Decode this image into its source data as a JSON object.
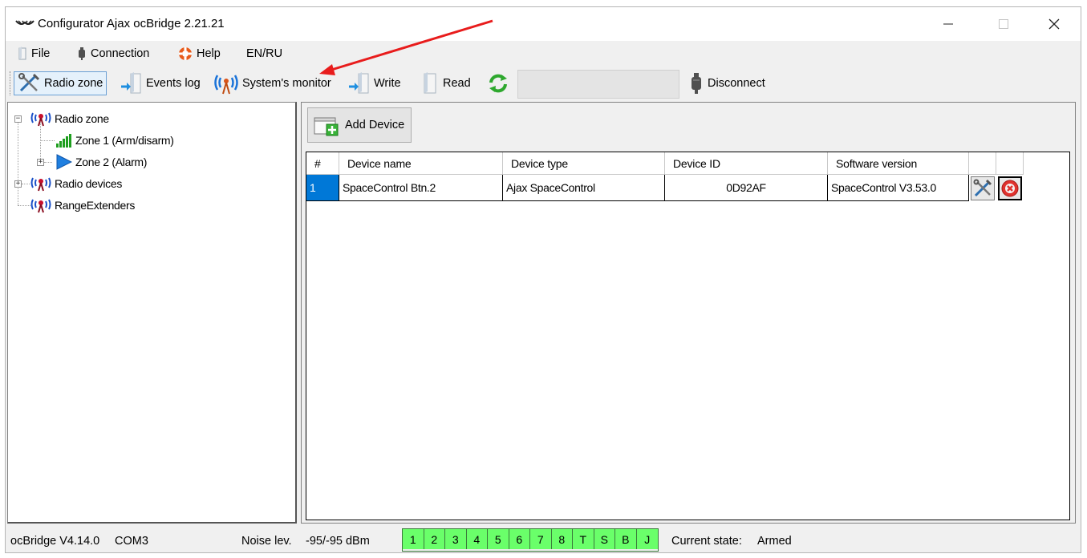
{
  "window": {
    "title": "Configurator Ajax ocBridge 2.21.21"
  },
  "menu": {
    "file": "File",
    "connection": "Connection",
    "help": "Help",
    "language": "EN/RU"
  },
  "toolbar": {
    "radio_zone": "Radio zone",
    "events_log": "Events log",
    "systems_monitor": "System's monitor",
    "write": "Write",
    "read": "Read",
    "disconnect": "Disconnect"
  },
  "tree": {
    "radio_zone": "Radio zone",
    "zone1": "Zone 1 (Arm/disarm)",
    "zone2": "Zone 2 (Alarm)",
    "radio_devices": "Radio devices",
    "range_extenders": "RangeExtenders"
  },
  "main": {
    "add_device": "Add Device",
    "columns": [
      "#",
      "Device name",
      "Device type",
      "Device ID",
      "Software version"
    ],
    "rows": [
      {
        "num": "1",
        "name": "SpaceControl Btn.2",
        "type": "Ajax SpaceControl",
        "id": "0D92AF",
        "version": "SpaceControl V3.53.0"
      }
    ]
  },
  "status": {
    "version": "ocBridge V4.14.0",
    "port": "COM3",
    "noise_label": "Noise lev.",
    "noise_value": "-95/-95 dBm",
    "indicators": [
      "1",
      "2",
      "3",
      "4",
      "5",
      "6",
      "7",
      "8",
      "T",
      "S",
      "B",
      "J"
    ],
    "state_label": "Current state:",
    "state_value": "Armed"
  },
  "colors": {
    "selection": "#0078d7",
    "indicator_green": "#6aff6a",
    "annotation_arrow": "#e81c1c"
  }
}
